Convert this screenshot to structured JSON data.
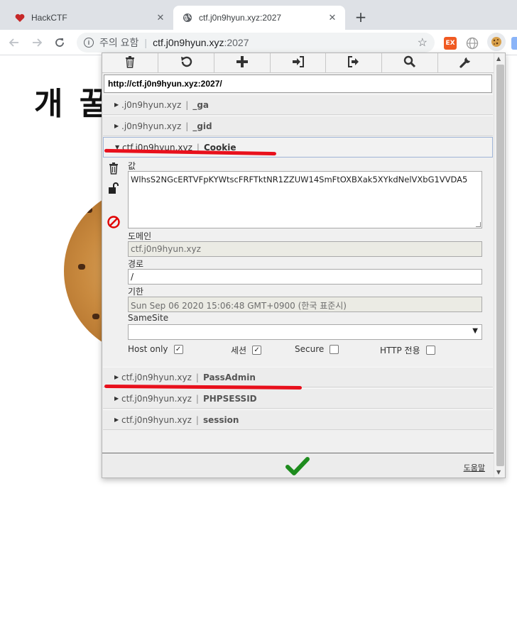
{
  "browser": {
    "tabs": [
      {
        "title": "HackCTF",
        "icon": "heart-icon",
        "active": false
      },
      {
        "title": "ctf.j0n9hyun.xyz:2027",
        "icon": "globe-icon",
        "active": true
      }
    ],
    "address": {
      "security_text": "주의 요함",
      "host": "ctf.j0n9hyun.xyz",
      "port": ":2027"
    },
    "extensions": [
      {
        "name": "ex-extension-icon",
        "label": "EX",
        "color": "#f05a22"
      },
      {
        "name": "globe-extension-icon",
        "color": "#9e9e9e"
      },
      {
        "name": "cookie-extension-icon",
        "color": "#d8a04b"
      }
    ]
  },
  "page": {
    "heading": "개 꿀"
  },
  "cookie_editor": {
    "toolbar": [
      "trash-icon",
      "refresh-icon",
      "add-icon",
      "import-icon",
      "export-icon",
      "search-icon",
      "wrench-icon"
    ],
    "url": "http://ctf.j0n9hyun.xyz:2027/",
    "cookies": [
      {
        "domain": ".j0n9hyun.xyz",
        "name": "_ga",
        "expanded": false
      },
      {
        "domain": ".j0n9hyun.xyz",
        "name": "_gid",
        "expanded": false
      },
      {
        "domain": "ctf.j0n9hyun.xyz",
        "name": "Cookie",
        "expanded": true
      },
      {
        "domain": "ctf.j0n9hyun.xyz",
        "name": "PassAdmin",
        "expanded": false
      },
      {
        "domain": "ctf.j0n9hyun.xyz",
        "name": "PHPSESSID",
        "expanded": false
      },
      {
        "domain": "ctf.j0n9hyun.xyz",
        "name": "session",
        "expanded": false
      }
    ],
    "detail": {
      "value_label": "값",
      "value": "WlhsS2NGcERTVFpKYWtscFRFTktNR1ZZUW14SmFtOXBXak5XYkdNelVXbG1VVDA5",
      "domain_label": "도메인",
      "domain": "ctf.j0n9hyun.xyz",
      "path_label": "경로",
      "path": "/",
      "expiry_label": "기한",
      "expiry": "Sun Sep 06 2020 15:06:48 GMT+0900 (한국 표준시)",
      "samesite_label": "SameSite",
      "samesite_value": "",
      "hostonly_label": "Host only",
      "hostonly_checked": true,
      "session_label": "세션",
      "session_checked": true,
      "secure_label": "Secure",
      "secure_checked": false,
      "httponly_label": "HTTP 전용",
      "httponly_checked": false
    },
    "help_label": "도움말",
    "accent_color": "#e8101c",
    "save_color": "#1e8c1e"
  }
}
